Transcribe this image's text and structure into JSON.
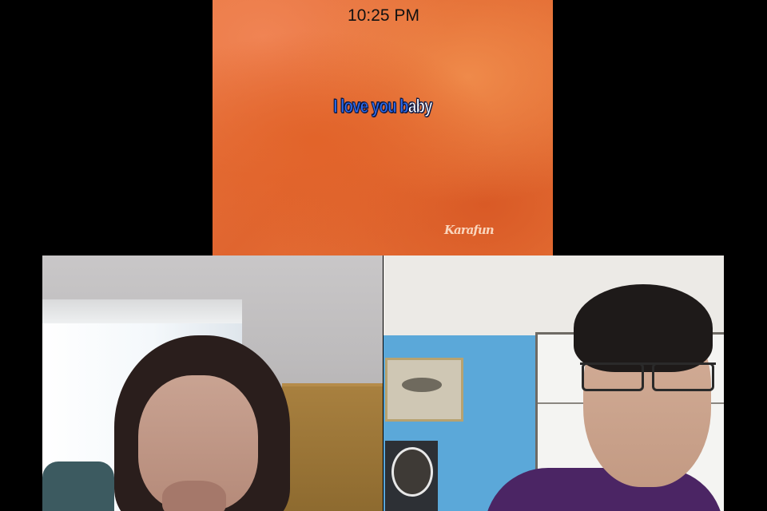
{
  "status_bar": {
    "time": "10:25 PM"
  },
  "shared_video": {
    "lyric_sung": "I love you b",
    "lyric_unsung": "aby",
    "watermark": "Karafun"
  },
  "participants": [
    {
      "position": "left"
    },
    {
      "position": "right"
    }
  ],
  "colors": {
    "background": "#000000",
    "lyric_sung": "#2e6df0",
    "lyric_unsung": "#ffffff",
    "video_orange": "#e8763f"
  }
}
